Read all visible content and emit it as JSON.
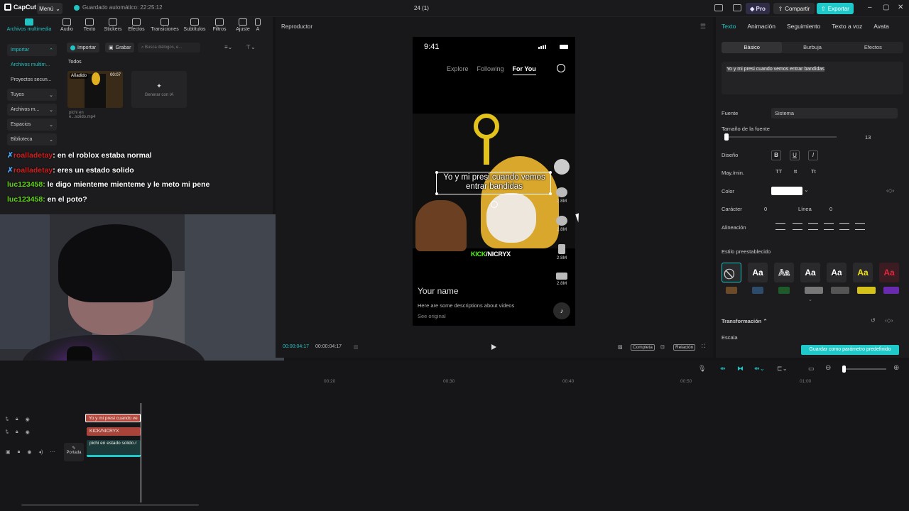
{
  "topbar": {
    "app_name": "CapCut",
    "menu_label": "Menú",
    "autosave": "Guardado automático: 22:25:12",
    "project_title": "24 (1)",
    "pro_label": "Pro",
    "share_label": "Compartir",
    "export_label": "Exportar"
  },
  "left_panel": {
    "tools": [
      {
        "label": "Archivos multimedia",
        "icon": "media-icon"
      },
      {
        "label": "Audio",
        "icon": "audio-icon"
      },
      {
        "label": "Texto",
        "icon": "text-icon"
      },
      {
        "label": "Stickers",
        "icon": "sticker-icon"
      },
      {
        "label": "Efectos",
        "icon": "effects-icon"
      },
      {
        "label": "Transiciones",
        "icon": "transition-icon"
      },
      {
        "label": "Subtítulos",
        "icon": "subtitle-icon"
      },
      {
        "label": "Filtros",
        "icon": "filter-icon"
      },
      {
        "label": "Ajuste",
        "icon": "adjust-icon"
      },
      {
        "label": "A",
        "icon": "more-icon"
      }
    ],
    "nav": [
      "Importar",
      "Archivos multim...",
      "Proyectos secun...",
      "Tuyos",
      "Archivos m...",
      "Espacios",
      "Biblioteca"
    ],
    "import_btn": "Importar",
    "record_btn": "Grabar",
    "search_placeholder": "Busca diálogos, e...",
    "todos": "Todos",
    "thumb_badge": "Añadido",
    "thumb_duration": "00:07",
    "thumb_name": "pichi en e...solido.mp4",
    "gen_ai": "Generar con IA"
  },
  "chat": [
    {
      "user": "roalladetay",
      "text": "en el roblox estaba normal"
    },
    {
      "user": "roalladetay",
      "text": "eres un estado solido"
    },
    {
      "user": "luc123458",
      "text": "le digo mienteme mienteme y le meto mi pene"
    },
    {
      "user": "luc123458",
      "text": "en el poto?"
    }
  ],
  "player": {
    "title": "Reproductor",
    "phone_time": "9:41",
    "tabs": [
      "Explore",
      "Following",
      "For You"
    ],
    "caption": "Yo y mi presi cuando vemos entrar bandidas",
    "kick": "KICK",
    "kick_user": "/NICRYX",
    "counts": [
      "2.8M",
      "2.8M",
      "2.8M",
      "2.8M"
    ],
    "name": "Your name",
    "desc": "Here are some descriptions about videos",
    "see_original": "See original",
    "time_current": "00:00:04:17",
    "time_total": "00:00:04:17",
    "full_label": "Completa",
    "ratio_label": "Relación"
  },
  "right_panel": {
    "tabs": [
      "Texto",
      "Animación",
      "Seguimiento",
      "Texto a voz",
      "Avata"
    ],
    "subtabs": [
      "Básico",
      "Burbuja",
      "Efectos"
    ],
    "text_value": "Yo y mi presi cuando vemos entrar bandidas",
    "font_label": "Fuente",
    "font_value": "Sistema",
    "size_label": "Tamaño de la fuente",
    "size_value": "13",
    "design_label": "Diseño",
    "case_label": "May./min.",
    "case_options": [
      "TT",
      "tt",
      "Tt"
    ],
    "color_label": "Color",
    "color_value": "#ffffff",
    "char_label": "Carácter",
    "char_value": "0",
    "line_label": "Línea",
    "line_value": "0",
    "align_label": "Alineación",
    "preset_label": "Estilo preestablecido",
    "preset_text": "Aa",
    "transform_label": "Transformación",
    "scale_label": "Escala",
    "save_preset": "Guardar como parámetro predefinido"
  },
  "timeline": {
    "ticks": [
      "00:20",
      "00:30",
      "00:40",
      "00:50",
      "01:00"
    ],
    "clip_text1": "Yo y mi presi cuando ve",
    "clip_text2": "KICK/NICRYX",
    "clip_video": "pichi en estado solido.r",
    "cover_label": "Portada"
  }
}
